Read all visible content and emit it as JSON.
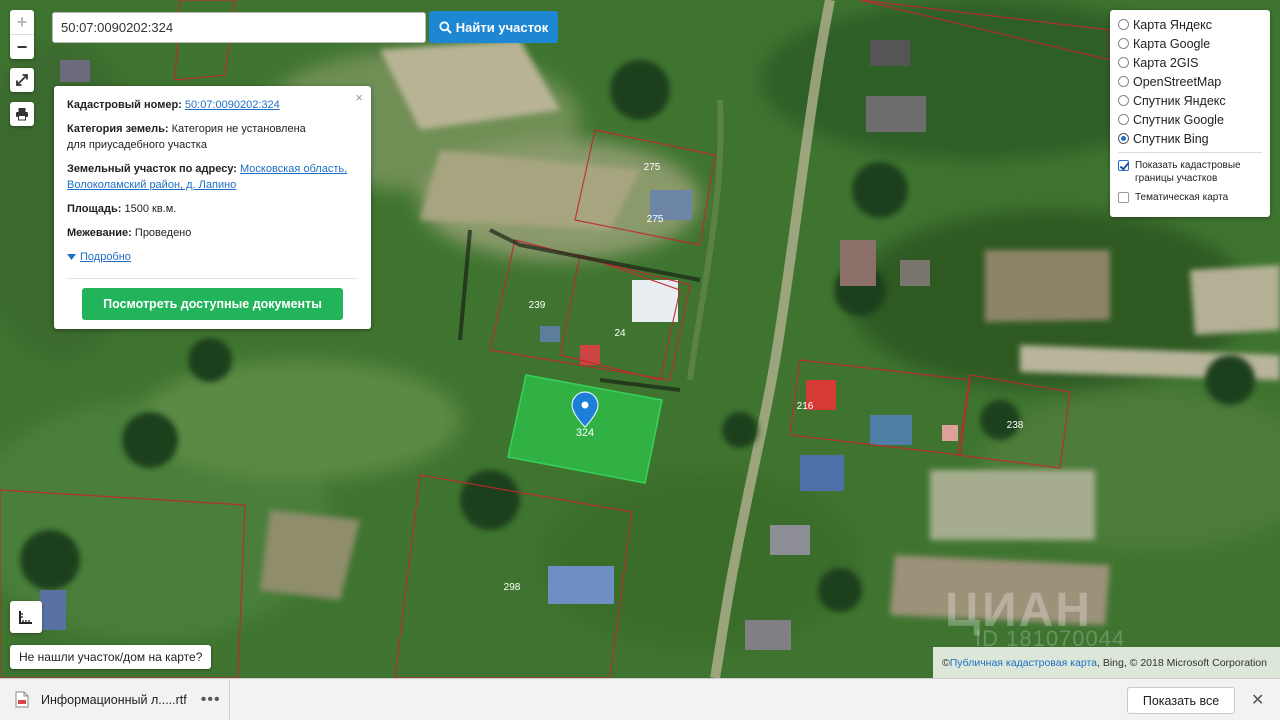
{
  "search": {
    "value": "50:07:0090202:324",
    "button_label": "Найти участок"
  },
  "zoom": {
    "in_label": "+",
    "out_label": "−"
  },
  "popup": {
    "close_label": "×",
    "cadastral_label": "Кадастровый номер:",
    "cadastral_value": "50:07:0090202:324",
    "category_label": "Категория земель:",
    "category_value": "Категория не установлена",
    "category_value_2": "для приусадебного участка",
    "address_label": "Земельный участок по адресу:",
    "address_value_1": "Московская область,",
    "address_value_2": "Волоколамский район, д. Лапино",
    "area_label": "Площадь:",
    "area_value": "1500 кв.м.",
    "survey_label": "Межевание:",
    "survey_value": "Проведено",
    "more_label": "Подробно",
    "docs_button_label": "Посмотреть доступные документы"
  },
  "layers": {
    "items": [
      {
        "label": "Карта Яндекс",
        "selected": false
      },
      {
        "label": "Карта Google",
        "selected": false
      },
      {
        "label": "Карта 2GIS",
        "selected": false
      },
      {
        "label": "OpenStreetMap",
        "selected": false
      },
      {
        "label": "Спутник Яндекс",
        "selected": false
      },
      {
        "label": "Спутник Google",
        "selected": false
      },
      {
        "label": "Спутник Bing",
        "selected": true
      }
    ],
    "show_borders_line1": "Показать кадастровые",
    "show_borders_line2": "границы участков",
    "show_borders_checked": true,
    "thematic_label": "Тематическая карта",
    "thematic_checked": false
  },
  "map": {
    "parcel_labels": [
      "275",
      "275",
      "239",
      "24",
      "324",
      "216",
      "238",
      "298"
    ],
    "accent_color": "#2ec44a",
    "boundary_color": "#c0282d"
  },
  "not_found_label": "Не нашли участок/дом на карте?",
  "attribution": {
    "prefix": "© ",
    "link": "Публичная кадастровая карта",
    "suffix": ", Bing, © 2018 Microsoft Corporation"
  },
  "watermark": {
    "brand": "ЦИАН",
    "id": "ID 181070044"
  },
  "downloads": {
    "file_name": "Информационный л.....rtf",
    "more_label": "•••",
    "show_all_label": "Показать все",
    "close_label": "✕"
  }
}
